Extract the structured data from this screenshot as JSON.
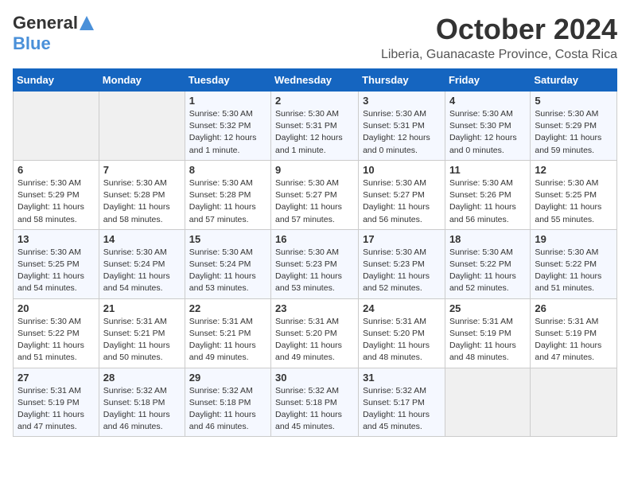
{
  "header": {
    "logo_general": "General",
    "logo_blue": "Blue",
    "title": "October 2024",
    "subtitle": "Liberia, Guanacaste Province, Costa Rica"
  },
  "weekdays": [
    "Sunday",
    "Monday",
    "Tuesday",
    "Wednesday",
    "Thursday",
    "Friday",
    "Saturday"
  ],
  "weeks": [
    [
      {
        "day": "",
        "detail": ""
      },
      {
        "day": "",
        "detail": ""
      },
      {
        "day": "1",
        "detail": "Sunrise: 5:30 AM\nSunset: 5:32 PM\nDaylight: 12 hours\nand 1 minute."
      },
      {
        "day": "2",
        "detail": "Sunrise: 5:30 AM\nSunset: 5:31 PM\nDaylight: 12 hours\nand 1 minute."
      },
      {
        "day": "3",
        "detail": "Sunrise: 5:30 AM\nSunset: 5:31 PM\nDaylight: 12 hours\nand 0 minutes."
      },
      {
        "day": "4",
        "detail": "Sunrise: 5:30 AM\nSunset: 5:30 PM\nDaylight: 12 hours\nand 0 minutes."
      },
      {
        "day": "5",
        "detail": "Sunrise: 5:30 AM\nSunset: 5:29 PM\nDaylight: 11 hours\nand 59 minutes."
      }
    ],
    [
      {
        "day": "6",
        "detail": "Sunrise: 5:30 AM\nSunset: 5:29 PM\nDaylight: 11 hours\nand 58 minutes."
      },
      {
        "day": "7",
        "detail": "Sunrise: 5:30 AM\nSunset: 5:28 PM\nDaylight: 11 hours\nand 58 minutes."
      },
      {
        "day": "8",
        "detail": "Sunrise: 5:30 AM\nSunset: 5:28 PM\nDaylight: 11 hours\nand 57 minutes."
      },
      {
        "day": "9",
        "detail": "Sunrise: 5:30 AM\nSunset: 5:27 PM\nDaylight: 11 hours\nand 57 minutes."
      },
      {
        "day": "10",
        "detail": "Sunrise: 5:30 AM\nSunset: 5:27 PM\nDaylight: 11 hours\nand 56 minutes."
      },
      {
        "day": "11",
        "detail": "Sunrise: 5:30 AM\nSunset: 5:26 PM\nDaylight: 11 hours\nand 56 minutes."
      },
      {
        "day": "12",
        "detail": "Sunrise: 5:30 AM\nSunset: 5:25 PM\nDaylight: 11 hours\nand 55 minutes."
      }
    ],
    [
      {
        "day": "13",
        "detail": "Sunrise: 5:30 AM\nSunset: 5:25 PM\nDaylight: 11 hours\nand 54 minutes."
      },
      {
        "day": "14",
        "detail": "Sunrise: 5:30 AM\nSunset: 5:24 PM\nDaylight: 11 hours\nand 54 minutes."
      },
      {
        "day": "15",
        "detail": "Sunrise: 5:30 AM\nSunset: 5:24 PM\nDaylight: 11 hours\nand 53 minutes."
      },
      {
        "day": "16",
        "detail": "Sunrise: 5:30 AM\nSunset: 5:23 PM\nDaylight: 11 hours\nand 53 minutes."
      },
      {
        "day": "17",
        "detail": "Sunrise: 5:30 AM\nSunset: 5:23 PM\nDaylight: 11 hours\nand 52 minutes."
      },
      {
        "day": "18",
        "detail": "Sunrise: 5:30 AM\nSunset: 5:22 PM\nDaylight: 11 hours\nand 52 minutes."
      },
      {
        "day": "19",
        "detail": "Sunrise: 5:30 AM\nSunset: 5:22 PM\nDaylight: 11 hours\nand 51 minutes."
      }
    ],
    [
      {
        "day": "20",
        "detail": "Sunrise: 5:30 AM\nSunset: 5:22 PM\nDaylight: 11 hours\nand 51 minutes."
      },
      {
        "day": "21",
        "detail": "Sunrise: 5:31 AM\nSunset: 5:21 PM\nDaylight: 11 hours\nand 50 minutes."
      },
      {
        "day": "22",
        "detail": "Sunrise: 5:31 AM\nSunset: 5:21 PM\nDaylight: 11 hours\nand 49 minutes."
      },
      {
        "day": "23",
        "detail": "Sunrise: 5:31 AM\nSunset: 5:20 PM\nDaylight: 11 hours\nand 49 minutes."
      },
      {
        "day": "24",
        "detail": "Sunrise: 5:31 AM\nSunset: 5:20 PM\nDaylight: 11 hours\nand 48 minutes."
      },
      {
        "day": "25",
        "detail": "Sunrise: 5:31 AM\nSunset: 5:19 PM\nDaylight: 11 hours\nand 48 minutes."
      },
      {
        "day": "26",
        "detail": "Sunrise: 5:31 AM\nSunset: 5:19 PM\nDaylight: 11 hours\nand 47 minutes."
      }
    ],
    [
      {
        "day": "27",
        "detail": "Sunrise: 5:31 AM\nSunset: 5:19 PM\nDaylight: 11 hours\nand 47 minutes."
      },
      {
        "day": "28",
        "detail": "Sunrise: 5:32 AM\nSunset: 5:18 PM\nDaylight: 11 hours\nand 46 minutes."
      },
      {
        "day": "29",
        "detail": "Sunrise: 5:32 AM\nSunset: 5:18 PM\nDaylight: 11 hours\nand 46 minutes."
      },
      {
        "day": "30",
        "detail": "Sunrise: 5:32 AM\nSunset: 5:18 PM\nDaylight: 11 hours\nand 45 minutes."
      },
      {
        "day": "31",
        "detail": "Sunrise: 5:32 AM\nSunset: 5:17 PM\nDaylight: 11 hours\nand 45 minutes."
      },
      {
        "day": "",
        "detail": ""
      },
      {
        "day": "",
        "detail": ""
      }
    ]
  ]
}
